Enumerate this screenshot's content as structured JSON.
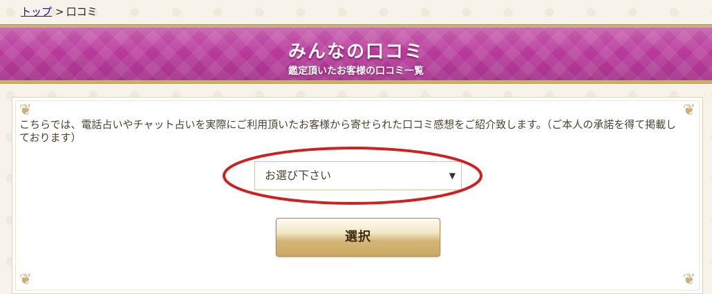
{
  "breadcrumb": {
    "top_link": "トップ",
    "separator": ">",
    "current": "口コミ"
  },
  "banner": {
    "title": "みんなの口コミ",
    "subtitle": "鑑定頂いたお客様の口コミ一覧"
  },
  "content": {
    "intro": "こちらでは、電話占いやチャット占いを実際にご利用頂いたお客様から寄せられた口コミ感想をご紹介致します。（ご本人の承諾を得て掲載しております）",
    "select": {
      "selected": "お選び下さい"
    },
    "submit_label": "選択"
  },
  "colors": {
    "banner": "#b83a9b",
    "gold_border": "#c9b16e",
    "annotation_ellipse": "#d0201e",
    "link": "#1a0dab"
  },
  "icons": {
    "select_chevron": "chevron-down-icon",
    "corner_ornament": "flourish-icon"
  }
}
